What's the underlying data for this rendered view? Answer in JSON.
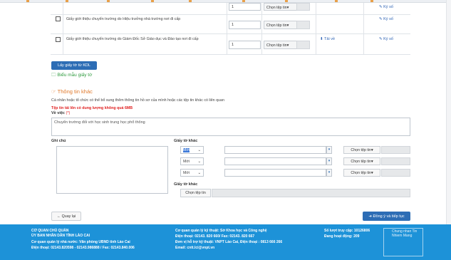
{
  "docs_table": {
    "rows": [
      {
        "text": "",
        "qty": "1",
        "file_select": "Chọn tệp tin▾",
        "download": "",
        "sign": "✎ Ký số"
      },
      {
        "text": "Giấy giới thiệu chuyển trường do Hiệu trưởng nhà trường nơi đi cấp",
        "qty": "1",
        "file_select": "Chọn tệp tin▾",
        "download": "",
        "sign": "✎ Ký số"
      },
      {
        "text": "Giấy giới thiệu chuyển trường do Giám Đốc Sở Giáo dục và Đào tạo nơi đi cấp",
        "qty": "1",
        "file_select": "Chọn tệp tin▾",
        "download": "⬇ Tải về",
        "sign": "✎ Ký số"
      }
    ]
  },
  "actions": {
    "get_kdl": "Lấy giấy tờ từ KDL",
    "forms_link": "Biểu mẫu giấy tờ"
  },
  "other_info": {
    "title": "Thông tin khác",
    "description": "Cá nhân hoặc tổ chức có thể bổ sung thêm thông tin hồ sơ của mình hoặc các tệp tin khác có liên quan",
    "size_warning": "Tệp tin tải lên có dung lượng không quá 6MB",
    "subject_label": "Về việc",
    "required_mark": "(*)",
    "subject_value": "Chuyển trường đối với học sinh trung học phổ thông",
    "notes_label": "Ghi chú",
    "other_docs_label": "Giấy tờ khác",
    "other_docs_rows": [
      {
        "status": "Mới",
        "file_select": "Chọn tệp tin▾"
      },
      {
        "status": "Mới",
        "file_select": "Chọn tệp tin▾"
      },
      {
        "status": "Mới",
        "file_select": "Chọn tệp tin▾"
      }
    ],
    "other_docs_label_2": "Giấy tờ khác",
    "choose_file": "Chọn tệp tin"
  },
  "nav": {
    "back": "← Quay lại",
    "agree": "➜ Đồng ý và tiếp tục"
  },
  "footer": {
    "org_title": "CƠ QUAN CHỦ QUẢN",
    "org_name": "ỦY BAN NHÂN DÂN TỈNH LÀO CAI",
    "managing_agency": "Cơ quan quản lý nhà nước: Văn phòng UBND tỉnh Lào Cai",
    "phone_left": "Điện thoại: 02143.820598 - 02143.986888 / Fax: 02143.840.006",
    "tech_agency": "Cơ quan quản lý kỹ thuật: Sở Khoa học và Công nghệ",
    "tech_phone": "Điện thoại: 02143. 820 660/ Fax: 02143. 820 667",
    "unit": "Đơn vị hỗ trợ kỹ thuật: VNPT Lào Cai, Điện thoại : 0813 666 266",
    "email": "Email: cntt.lci@vnpt.vn",
    "visits": "Số lượt truy cập: 10126806",
    "online": "Đang hoạt động: 209",
    "logo_alt": "Chung nhan Tin Nhiem Mang"
  }
}
